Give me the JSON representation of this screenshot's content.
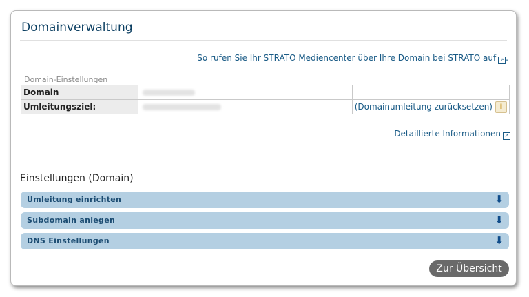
{
  "header": {
    "title": "Domainverwaltung"
  },
  "links": {
    "mediencenter": "So rufen Sie Ihr STRATO Mediencenter über Ihre Domain bei STRATO auf",
    "mediencenter_suffix": ".",
    "details": "Detaillierte Informationen"
  },
  "domain_settings": {
    "legend": "Domain-Einstellungen",
    "rows": [
      {
        "label": "Domain",
        "action": ""
      },
      {
        "label": "Umleitungsziel:",
        "action": "(Domainumleitung zurücksetzen)"
      }
    ],
    "info_icon": "i"
  },
  "settings": {
    "title": "Einstellungen (Domain)",
    "sections": [
      {
        "label": "Umleitung einrichten",
        "icon": "arrow-down-icon"
      },
      {
        "label": "Subdomain anlegen",
        "icon": "arrow-down-icon"
      },
      {
        "label": "DNS Einstellungen",
        "icon": "arrow-down-icon"
      }
    ]
  },
  "buttons": {
    "overview": "Zur Übersicht"
  },
  "colors": {
    "link": "#1a5b86",
    "accordion": "#b4cfe2",
    "button": "#6a6a6a"
  }
}
